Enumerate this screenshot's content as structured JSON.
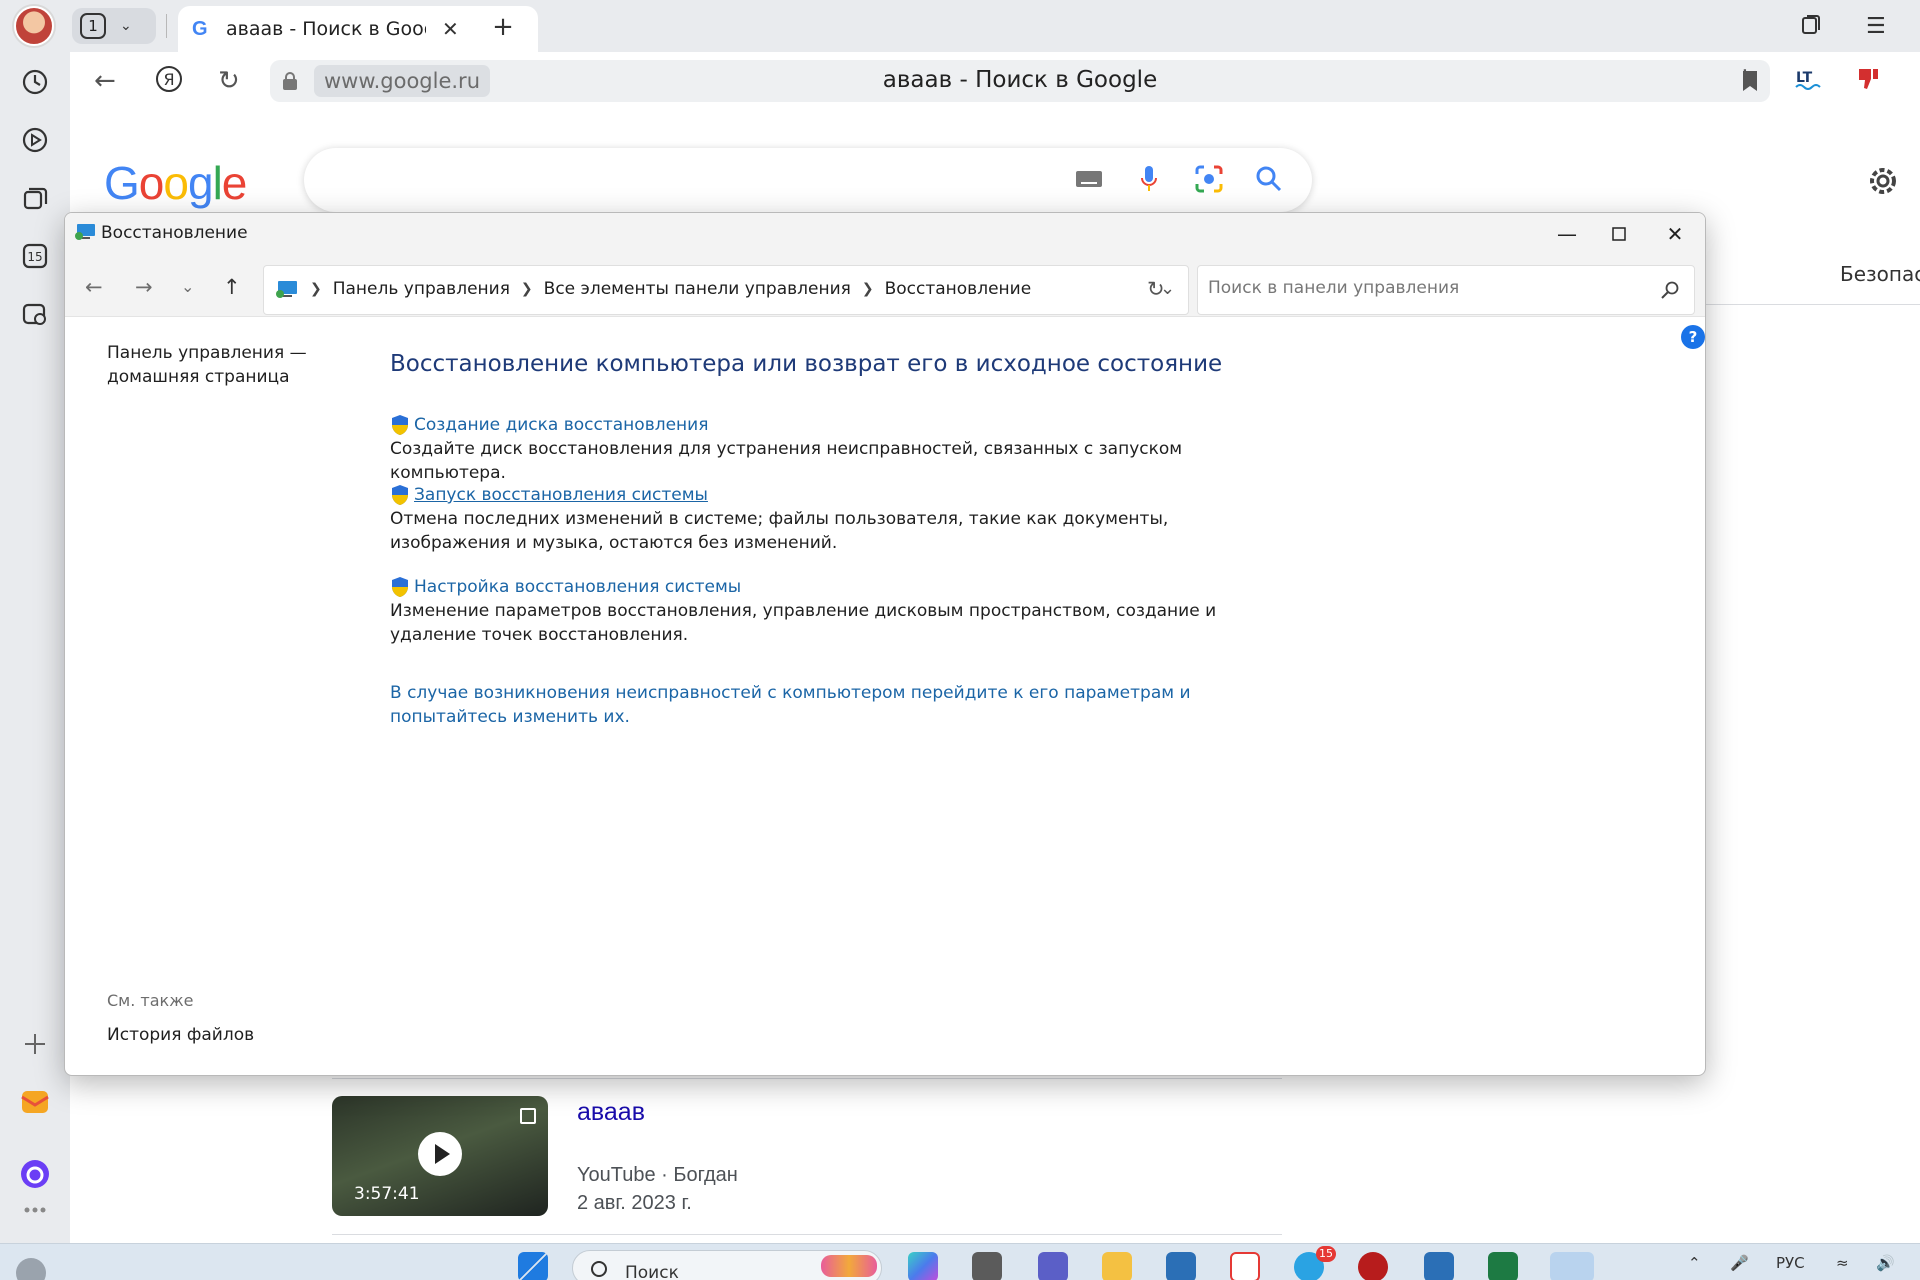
{
  "browser": {
    "tab_count": "1",
    "active_tab_title": "аваав - Поиск в Google",
    "domain": "www.google.ru",
    "page_title": "аваав - Поиск в Google",
    "calendar_day": "15"
  },
  "google": {
    "logo": "Google",
    "safe_search_label": "Безопаснь",
    "video": {
      "title": "аваав",
      "duration": "3:57:41",
      "source": "YouTube · Богдан",
      "date": "2 авг. 2023 г."
    }
  },
  "control_panel": {
    "window_title": "Восстановление",
    "breadcrumbs": [
      "Панель управления",
      "Все элементы панели управления",
      "Восстановление"
    ],
    "search_placeholder": "Поиск в панели управления",
    "left_pane": {
      "home_link": "Панель управления — домашняя страница",
      "see_also_label": "См. также",
      "file_history_link": "История файлов"
    },
    "heading": "Восстановление компьютера или возврат его в исходное состояние",
    "tasks": [
      {
        "link": "Создание диска восстановления",
        "description": "Создайте диск восстановления для устранения неисправностей, связанных с запуском компьютера."
      },
      {
        "link": "Запуск восстановления системы",
        "description": "Отмена последних изменений в системе; файлы пользователя, такие как документы, изображения и музыка, остаются без изменений."
      },
      {
        "link": "Настройка восстановления системы",
        "description": "Изменение параметров восстановления, управление дисковым пространством, создание и удаление точек восстановления."
      }
    ],
    "bottom_link": "В случае возникновения неисправностей с компьютером перейдите к его параметрам и попытайтесь изменить их."
  },
  "taskbar": {
    "search_placeholder": "Поиск",
    "telegram_badge": "15",
    "language": "РУС"
  },
  "colors": {
    "link_blue": "#1b65a6",
    "heading_blue": "#1e3a78",
    "browser_chrome": "#e9ebee",
    "google_result_title": "#1a0dab"
  }
}
